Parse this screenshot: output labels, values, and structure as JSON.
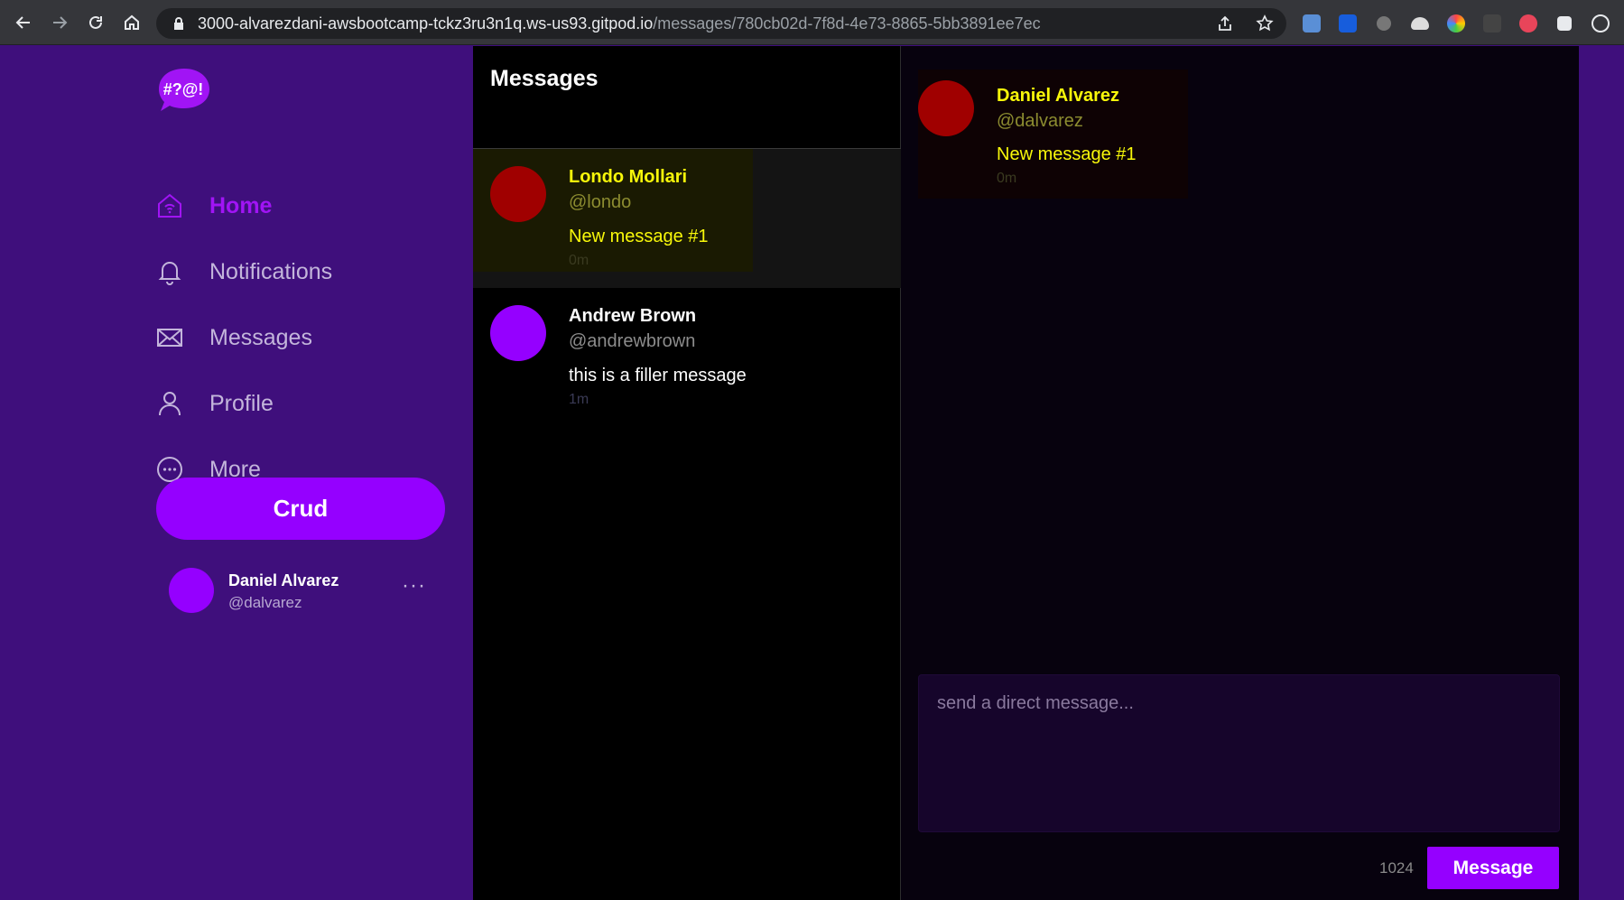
{
  "browser": {
    "url_host": "3000-alvarezdani-awsbootcamp-tckz3ru3n1q.ws-us93.gitpod.io",
    "url_path": "/messages/780cb02d-7f8d-4e73-8865-5bb3891ee7ec"
  },
  "sidebar": {
    "logo_text": "#?@!",
    "items": [
      {
        "label": "Home",
        "icon": "home-icon",
        "active": true
      },
      {
        "label": "Notifications",
        "icon": "bell-icon",
        "active": false
      },
      {
        "label": "Messages",
        "icon": "envelope-icon",
        "active": false
      },
      {
        "label": "Profile",
        "icon": "user-icon",
        "active": false
      },
      {
        "label": "More",
        "icon": "more-circle-icon",
        "active": false
      }
    ],
    "crud_label": "Crud",
    "profile": {
      "name": "Daniel Alvarez",
      "handle": "@dalvarez",
      "more": "···"
    }
  },
  "message_groups": {
    "title": "Messages",
    "groups": [
      {
        "name": "Londo Mollari",
        "handle": "@londo",
        "message": "New message #1",
        "time": "0m",
        "selected": true,
        "avatar_color": "#a00000",
        "name_color": "#f8f80a",
        "handle_color": "#8c8c30",
        "message_color": "#f8f80a"
      },
      {
        "name": "Andrew Brown",
        "handle": "@andrewbrown",
        "message": "this is a filler message",
        "time": "1m",
        "selected": false,
        "avatar_color": "#9500ff",
        "name_color": "#ffffff",
        "handle_color": "#8c8c8c",
        "message_color": "#ffffff"
      }
    ]
  },
  "conversation": {
    "messages": [
      {
        "name": "Daniel Alvarez",
        "handle": "@dalvarez",
        "message": "New message #1",
        "time": "0m"
      }
    ],
    "composer_placeholder": "send a direct message...",
    "char_count": "1024",
    "send_label": "Message"
  },
  "colors": {
    "sidebar_bg": "#3f0f7c",
    "accent": "#9500ff",
    "highlight_text": "#f8f80a"
  }
}
